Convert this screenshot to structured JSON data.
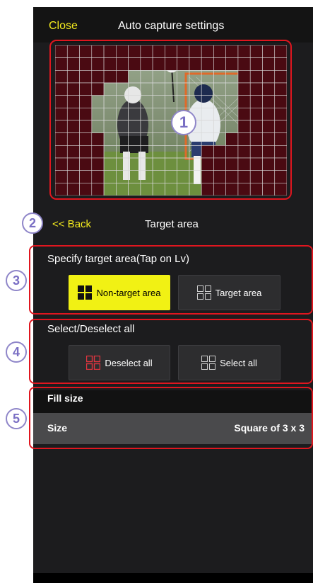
{
  "header": {
    "close_label": "Close",
    "title": "Auto capture settings"
  },
  "preview": {
    "grid_cols": 19,
    "grid_rows": 12,
    "non_target_cells": [
      "0,0",
      "1,0",
      "2,0",
      "3,0",
      "4,0",
      "5,0",
      "6,0",
      "7,0",
      "8,0",
      "9,0",
      "10,0",
      "11,0",
      "12,0",
      "13,0",
      "14,0",
      "15,0",
      "16,0",
      "17,0",
      "18,0",
      "0,1",
      "1,1",
      "2,1",
      "3,1",
      "4,1",
      "5,1",
      "6,1",
      "7,1",
      "8,1",
      "9,1",
      "10,1",
      "11,1",
      "12,1",
      "13,1",
      "14,1",
      "15,1",
      "16,1",
      "17,1",
      "18,1",
      "0,2",
      "1,2",
      "2,2",
      "3,2",
      "4,2",
      "5,2",
      "15,2",
      "16,2",
      "17,2",
      "18,2",
      "0,3",
      "1,3",
      "2,3",
      "3,3",
      "15,3",
      "16,3",
      "17,3",
      "18,3",
      "0,4",
      "1,4",
      "2,4",
      "15,4",
      "16,4",
      "17,4",
      "18,4",
      "0,5",
      "1,5",
      "2,5",
      "15,5",
      "16,5",
      "17,5",
      "18,5",
      "0,6",
      "1,6",
      "2,6",
      "15,6",
      "16,6",
      "17,6",
      "18,6",
      "0,7",
      "1,7",
      "2,7",
      "3,7",
      "14,7",
      "15,7",
      "16,7",
      "17,7",
      "18,7",
      "0,8",
      "1,8",
      "2,8",
      "3,8",
      "12,8",
      "13,8",
      "14,8",
      "15,8",
      "16,8",
      "17,8",
      "18,8",
      "0,9",
      "1,9",
      "2,9",
      "3,9",
      "12,9",
      "13,9",
      "14,9",
      "15,9",
      "16,9",
      "17,9",
      "18,9",
      "0,10",
      "1,10",
      "2,10",
      "3,10",
      "12,10",
      "13,10",
      "14,10",
      "15,10",
      "16,10",
      "17,10",
      "18,10",
      "0,11",
      "1,11",
      "2,11",
      "3,11",
      "12,11",
      "13,11",
      "14,11",
      "15,11",
      "16,11",
      "17,11",
      "18,11"
    ],
    "cell_color": "#4a0a12"
  },
  "subheader": {
    "back_label": "<< Back",
    "title": "Target area"
  },
  "specify": {
    "label": "Specify target area(Tap on Lv)",
    "non_target_label": "Non-target area",
    "target_label": "Target area"
  },
  "select_all": {
    "label": "Select/Deselect all",
    "deselect_label": "Deselect all",
    "select_label": "Select all"
  },
  "fill": {
    "header": "Fill size",
    "size_label": "Size",
    "size_value": "Square of 3 x 3"
  },
  "callouts": {
    "one": "1",
    "two": "2",
    "three": "3",
    "four": "4",
    "five": "5"
  },
  "colors": {
    "accent_yellow": "#f3ea1e",
    "callout_red": "#e0161f",
    "callout_purple": "#7a6fc4"
  }
}
